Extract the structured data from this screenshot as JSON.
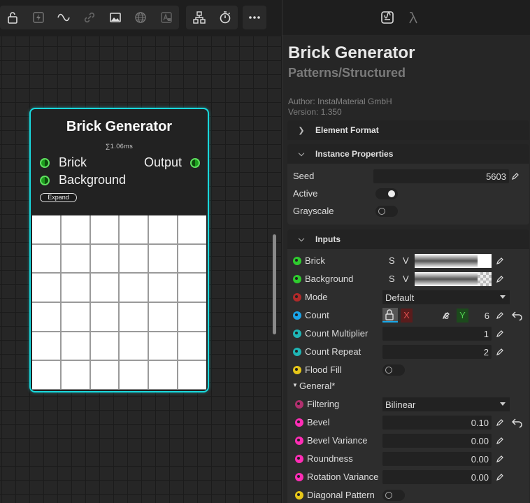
{
  "toolbar": {
    "icons": [
      "unlock-icon",
      "flash-icon",
      "wave-icon",
      "link-icon",
      "image-icon",
      "globe-icon",
      "font-image-icon",
      "hierarchy-icon",
      "stopwatch-icon",
      "more-icon"
    ]
  },
  "node": {
    "title": "Brick Generator",
    "time": "∑1.06ms",
    "inputs": [
      "Brick",
      "Background"
    ],
    "output": "Output",
    "expand_label": "Expand",
    "border_color": "#19d9dd"
  },
  "panel": {
    "tabs": [
      "node-properties-icon",
      "lambda-icon"
    ],
    "title": "Brick Generator",
    "subtitle": "Patterns/Structured",
    "author": "Author: InstaMaterial GmbH",
    "version": "Version: 1.350",
    "sections": {
      "element_format": "Element Format",
      "instance_properties": "Instance Properties",
      "inputs": "Inputs",
      "general": "General*"
    },
    "instance": {
      "seed_label": "Seed",
      "seed_value": "5603",
      "active_label": "Active",
      "active_on": true,
      "grayscale_label": "Grayscale",
      "grayscale_on": false
    },
    "inputs": {
      "brick_label": "Brick",
      "background_label": "Background",
      "s_label": "S",
      "v_label": "V",
      "mode_label": "Mode",
      "mode_value": "Default",
      "count_label": "Count",
      "count_x_label": "X",
      "count_x": "6",
      "count_y_label": "Y",
      "count_y": "6",
      "count_multiplier_label": "Count Multiplier",
      "count_multiplier": "1",
      "count_repeat_label": "Count Repeat",
      "count_repeat": "2",
      "flood_fill_label": "Flood Fill",
      "flood_fill_on": false
    },
    "general": {
      "filtering_label": "Filtering",
      "filtering_value": "Bilinear",
      "bevel_label": "Bevel",
      "bevel_value": "0.10",
      "bevel_variance_label": "Bevel Variance",
      "bevel_variance_value": "0.00",
      "roundness_label": "Roundness",
      "roundness_value": "0.00",
      "rotation_variance_label": "Rotation Variance",
      "rotation_variance_value": "0.00",
      "diagonal_pattern_label": "Diagonal Pattern",
      "diagonal_pattern_on": false
    },
    "pin_colors": {
      "green": "#2ecc2e",
      "red": "#b02a2a",
      "blue": "#1aa3e8",
      "teal": "#1fb5b5",
      "yellow": "#e6c619",
      "purple": "#b0306e",
      "magenta": "#ff2db5"
    }
  }
}
